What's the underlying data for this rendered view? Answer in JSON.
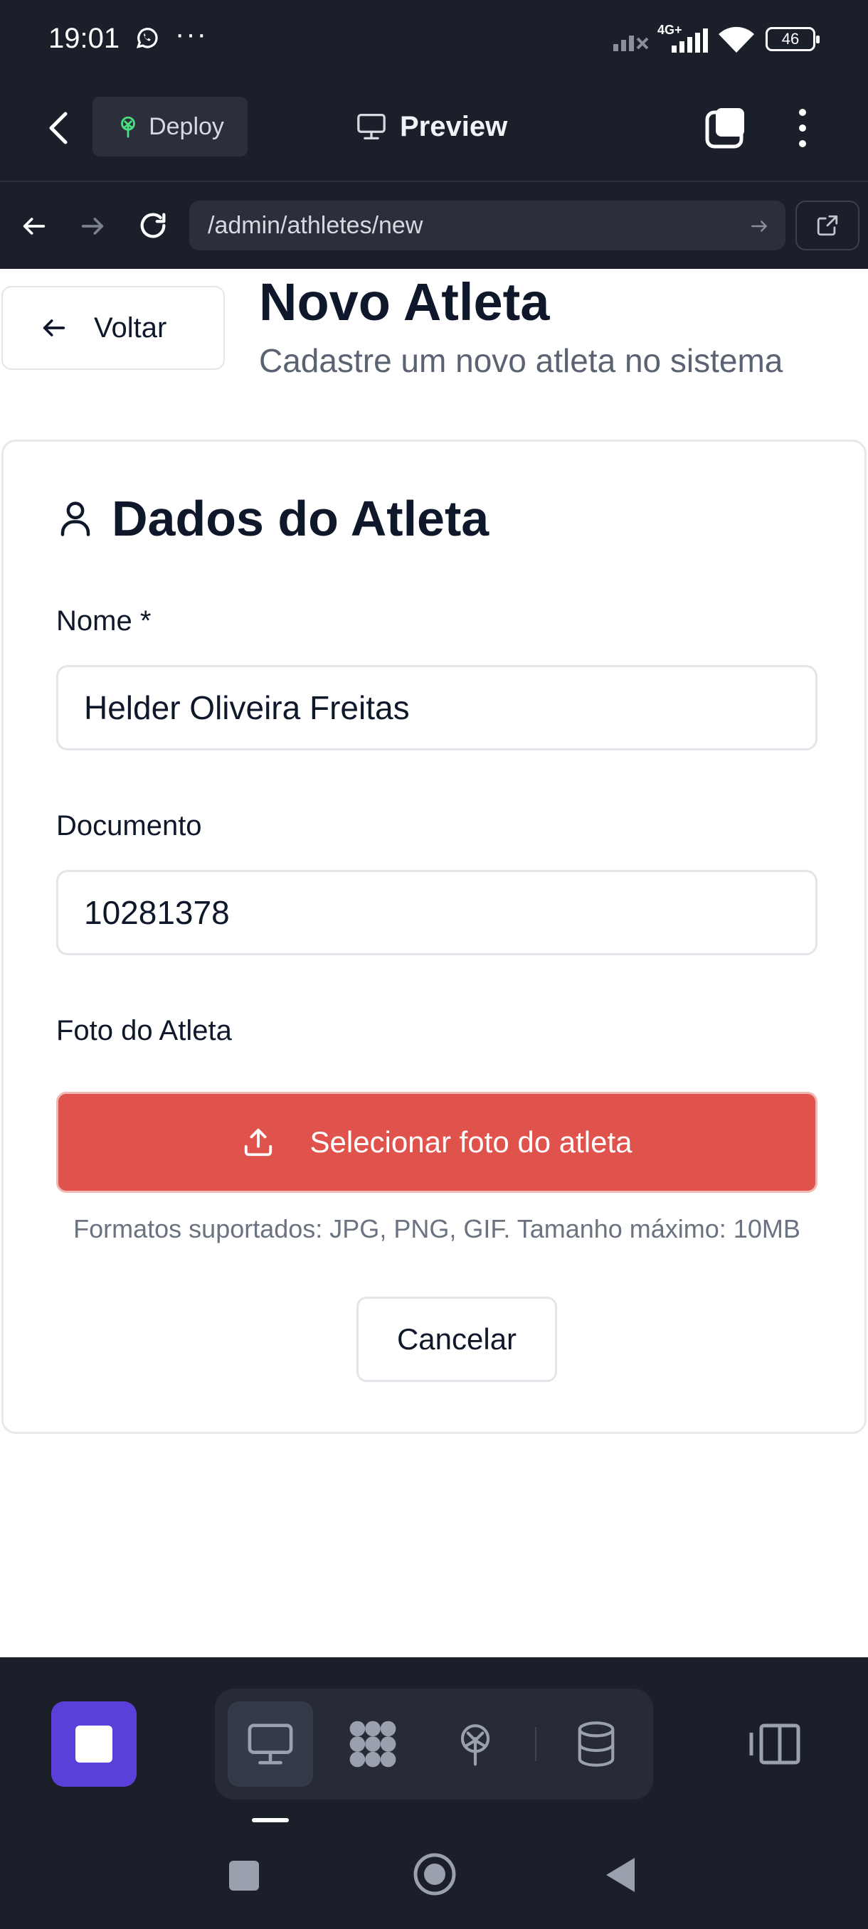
{
  "status_bar": {
    "time": "19:01",
    "network": "4G+",
    "battery": "46",
    "icons": [
      "whatsapp-icon",
      "more-dots-icon",
      "signal-icon",
      "wifi-icon",
      "battery-icon"
    ]
  },
  "app_bar": {
    "deploy_label": "Deploy",
    "preview_label": "Preview",
    "icons": [
      "back-chevron-icon",
      "deploy-icon",
      "monitor-icon",
      "tabs-icon",
      "kebab-menu-icon"
    ]
  },
  "browser": {
    "url": "/admin/athletes/new",
    "icons": [
      "arrow-left-icon",
      "arrow-right-icon",
      "reload-icon",
      "go-arrow-icon",
      "external-link-icon"
    ]
  },
  "page": {
    "back_label": "Voltar",
    "title": "Novo Atleta",
    "subtitle": "Cadastre um novo atleta no sistema"
  },
  "form": {
    "card_title": "Dados do Atleta",
    "name_label": "Nome *",
    "name_value": "Helder Oliveira Freitas",
    "document_label": "Documento",
    "document_value": "10281378",
    "photo_label": "Foto do Atleta",
    "upload_button": "Selecionar foto do atleta",
    "formats_hint": "Formatos suportados: JPG, PNG, GIF. Tamanho máximo: 10MB",
    "cancel_button": "Cancelar"
  },
  "bottom_bar": {
    "icons": [
      "stop-icon",
      "monitor-icon",
      "grid-icon",
      "deploy-icon",
      "database-icon",
      "side-panel-icon"
    ],
    "active_tab": "monitor-icon"
  },
  "colors": {
    "dark_bg": "#1b1f2a",
    "accent_red": "#e0534d",
    "accent_purple": "#5b3fd9"
  }
}
